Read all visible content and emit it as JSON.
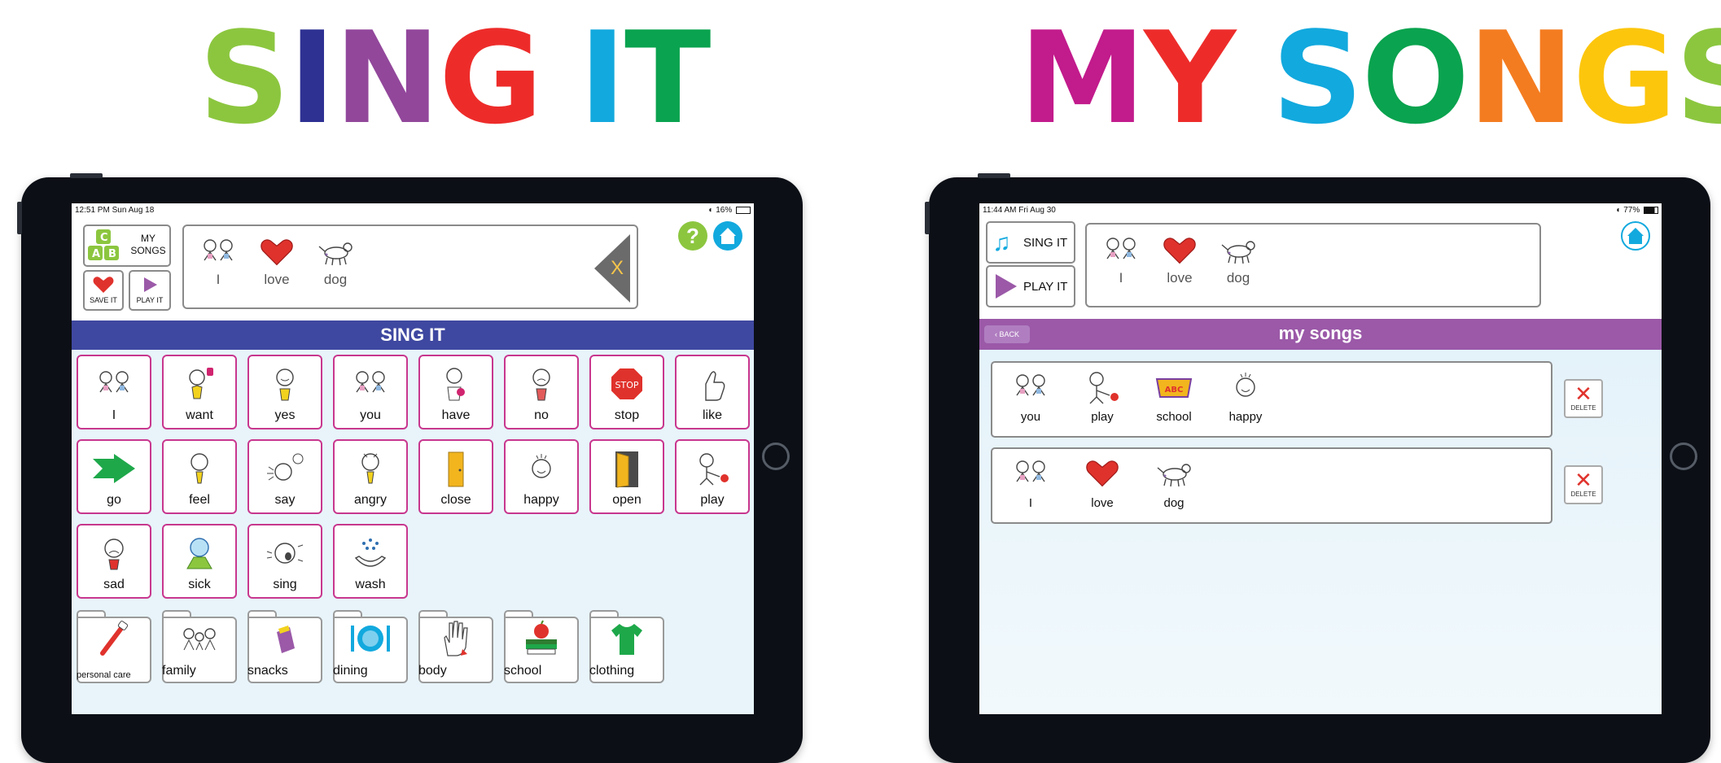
{
  "left_title": {
    "letters": [
      {
        "ch": "S",
        "color": "#8cc63f"
      },
      {
        "ch": "I",
        "color": "#2e3192"
      },
      {
        "ch": "N",
        "color": "#92479b"
      },
      {
        "ch": "G",
        "color": "#ed2c2a"
      },
      {
        "ch": " ",
        "color": "#ffffff"
      },
      {
        "ch": "I",
        "color": "#12a9de"
      },
      {
        "ch": "T",
        "color": "#0aa34f"
      }
    ]
  },
  "right_title": {
    "letters": [
      {
        "ch": "M",
        "color": "#c21b8c"
      },
      {
        "ch": "Y",
        "color": "#ed2c2a"
      },
      {
        "ch": " ",
        "color": "#ffffff"
      },
      {
        "ch": "S",
        "color": "#12a9de"
      },
      {
        "ch": "O",
        "color": "#0aa34f"
      },
      {
        "ch": "N",
        "color": "#f47c20"
      },
      {
        "ch": "G",
        "color": "#fcc60d"
      },
      {
        "ch": "S",
        "color": "#8cc63f"
      }
    ]
  },
  "sing_it": {
    "status": {
      "time": "12:51 PM   Sun Aug 18",
      "right": "16%"
    },
    "my_songs_button": "MY\nSONGS",
    "save_it_label": "SAVE IT",
    "play_it_label": "PLAY IT",
    "clear_label": "X",
    "strip": [
      {
        "label": "I",
        "icon": "friends-icon"
      },
      {
        "label": "love",
        "icon": "heart-icon"
      },
      {
        "label": "dog",
        "icon": "dog-icon"
      }
    ],
    "header": "SING IT",
    "header_color": "#3f48a0",
    "words": [
      {
        "label": "I",
        "icon": "friends-icon"
      },
      {
        "label": "want",
        "icon": "want-icon"
      },
      {
        "label": "yes",
        "icon": "yes-icon"
      },
      {
        "label": "you",
        "icon": "friends-icon"
      },
      {
        "label": "have",
        "icon": "have-icon"
      },
      {
        "label": "no",
        "icon": "no-icon"
      },
      {
        "label": "stop",
        "icon": "stop-sign-icon"
      },
      {
        "label": "like",
        "icon": "thumbs-up-icon"
      },
      {
        "label": "go",
        "icon": "arrow-right-icon"
      },
      {
        "label": "feel",
        "icon": "feel-icon"
      },
      {
        "label": "say",
        "icon": "say-icon"
      },
      {
        "label": "angry",
        "icon": "angry-icon"
      },
      {
        "label": "close",
        "icon": "closed-door-icon"
      },
      {
        "label": "happy",
        "icon": "happy-icon"
      },
      {
        "label": "open",
        "icon": "open-door-icon"
      },
      {
        "label": "play",
        "icon": "play-ball-icon"
      },
      {
        "label": "sad",
        "icon": "sad-icon"
      },
      {
        "label": "sick",
        "icon": "sick-icon"
      },
      {
        "label": "sing",
        "icon": "sing-icon"
      },
      {
        "label": "wash",
        "icon": "wash-icon"
      }
    ],
    "folders": [
      {
        "label": "personal care",
        "icon": "toothbrush-icon"
      },
      {
        "label": "family",
        "icon": "family-icon"
      },
      {
        "label": "snacks",
        "icon": "snack-icon"
      },
      {
        "label": "dining",
        "icon": "plate-icon"
      },
      {
        "label": "body",
        "icon": "hand-icon"
      },
      {
        "label": "school",
        "icon": "books-apple-icon"
      },
      {
        "label": "clothing",
        "icon": "shirt-icon"
      }
    ]
  },
  "my_songs": {
    "status": {
      "time": "11:44 AM   Fri Aug 30",
      "right": "77%"
    },
    "sing_it_button": "SING IT",
    "play_it_button": "PLAY IT",
    "strip": [
      {
        "label": "I",
        "icon": "friends-icon"
      },
      {
        "label": "love",
        "icon": "heart-icon"
      },
      {
        "label": "dog",
        "icon": "dog-icon"
      }
    ],
    "back_label": "BACK",
    "header": "my songs",
    "header_color": "#9b59a8",
    "delete_label": "DELETE",
    "songs": [
      [
        {
          "label": "you",
          "icon": "friends-icon"
        },
        {
          "label": "play",
          "icon": "play-ball-icon"
        },
        {
          "label": "school",
          "icon": "school-sign-icon"
        },
        {
          "label": "happy",
          "icon": "happy-icon"
        }
      ],
      [
        {
          "label": "I",
          "icon": "friends-icon"
        },
        {
          "label": "love",
          "icon": "heart-icon"
        },
        {
          "label": "dog",
          "icon": "dog-icon"
        }
      ]
    ]
  }
}
